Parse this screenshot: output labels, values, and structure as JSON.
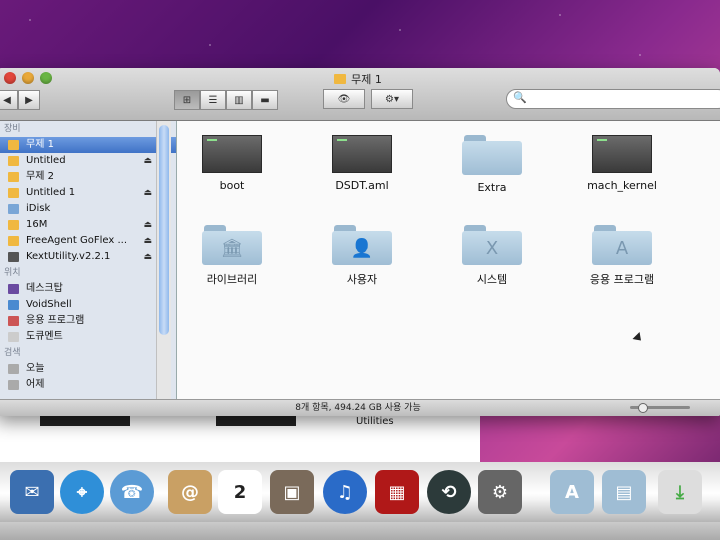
{
  "window": {
    "title": "무제 1",
    "search_placeholder": "",
    "status": "8개 항목, 494.24 GB 사용 가능"
  },
  "sidebar": {
    "devices_title": "장비",
    "devices": [
      {
        "label": "무제 1",
        "icon": "drive-icon",
        "selected": true,
        "eject": false
      },
      {
        "label": "Untitled",
        "icon": "drive-icon",
        "selected": false,
        "eject": true
      },
      {
        "label": "무제 2",
        "icon": "drive-icon",
        "selected": false,
        "eject": false
      },
      {
        "label": "Untitled 1",
        "icon": "drive-icon",
        "selected": false,
        "eject": true
      },
      {
        "label": "iDisk",
        "icon": "idisk-icon",
        "selected": false,
        "eject": false
      },
      {
        "label": "16M",
        "icon": "drive-icon",
        "selected": false,
        "eject": true
      },
      {
        "label": "FreeAgent GoFlex ...",
        "icon": "drive-icon",
        "selected": false,
        "eject": true
      },
      {
        "label": "KextUtility.v2.2.1",
        "icon": "disk-image-icon",
        "selected": false,
        "eject": true
      }
    ],
    "places_title": "위치",
    "places": [
      {
        "label": "데스크탑",
        "icon": "desktop-icon"
      },
      {
        "label": "VoidShell",
        "icon": "home-icon"
      },
      {
        "label": "응용 프로그램",
        "icon": "applications-icon"
      },
      {
        "label": "도큐멘트",
        "icon": "documents-icon"
      }
    ],
    "search_title": "검색",
    "search_items": [
      {
        "label": "오늘",
        "icon": "clock-icon"
      },
      {
        "label": "어제",
        "icon": "clock-icon"
      }
    ]
  },
  "files": [
    {
      "label": "boot",
      "kind": "executable"
    },
    {
      "label": "DSDT.aml",
      "kind": "executable"
    },
    {
      "label": "Extra",
      "kind": "folder",
      "glyph": ""
    },
    {
      "label": "mach_kernel",
      "kind": "executable"
    },
    {
      "label": "라이브러리",
      "kind": "folder",
      "glyph": "🏛"
    },
    {
      "label": "사용자",
      "kind": "folder",
      "glyph": "👤"
    },
    {
      "label": "시스템",
      "kind": "folder",
      "glyph": "X"
    },
    {
      "label": "응용 프로그램",
      "kind": "folder",
      "glyph": "A"
    }
  ],
  "background_window_text": "Utilities",
  "dock_calendar_day": "2",
  "colors": {
    "accent": "#3f72c6",
    "folder": "#9fbdd4"
  }
}
